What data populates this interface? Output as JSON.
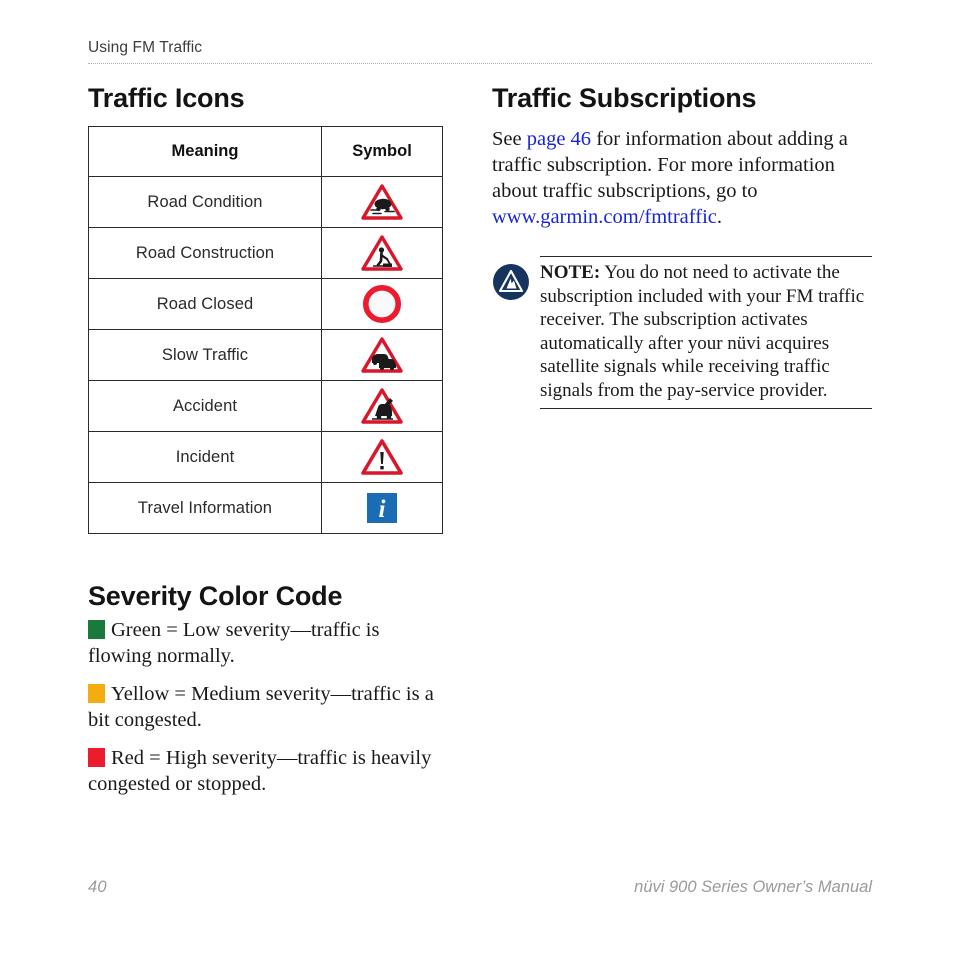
{
  "header": {
    "running_head": "Using FM Traffic"
  },
  "left_column": {
    "traffic_icons": {
      "heading": "Traffic Icons",
      "table": {
        "columns": [
          "Meaning",
          "Symbol"
        ],
        "rows": [
          {
            "meaning": "Road Condition",
            "symbol_icon": "slippery-road-warning-icon"
          },
          {
            "meaning": "Road Construction",
            "symbol_icon": "road-works-warning-icon"
          },
          {
            "meaning": "Road Closed",
            "symbol_icon": "road-closed-circle-icon"
          },
          {
            "meaning": "Slow Traffic",
            "symbol_icon": "traffic-queue-warning-icon"
          },
          {
            "meaning": "Accident",
            "symbol_icon": "accident-warning-icon"
          },
          {
            "meaning": "Incident",
            "symbol_icon": "general-warning-exclamation-icon"
          },
          {
            "meaning": "Travel Information",
            "symbol_icon": "travel-information-info-icon"
          }
        ]
      }
    },
    "severity": {
      "heading": "Severity Color Code",
      "items": [
        {
          "swatch_color": "#1a7a3c",
          "swatch_name": "green-severity-swatch",
          "text": "Green = Low severity—traffic is flowing normally."
        },
        {
          "swatch_color": "#f4ad10",
          "swatch_name": "yellow-severity-swatch",
          "text": "Yellow = Medium severity—traffic is a bit congested."
        },
        {
          "swatch_color": "#ed1b2e",
          "swatch_name": "red-severity-swatch",
          "text": "Red = High severity—traffic is heavily congested or stopped."
        }
      ]
    }
  },
  "right_column": {
    "subscriptions": {
      "heading": "Traffic Subscriptions",
      "paragraph_part1": "See ",
      "link_page": "page 46",
      "paragraph_part2": " for information about adding a traffic subscription. For more information about traffic subscriptions, go to ",
      "link_url": "www.garmin.com/fmtraffic",
      "paragraph_part3": "."
    },
    "note": {
      "icon": "garmin-logo-icon",
      "label": "NOTE:",
      "text": " You do not need to activate the subscription included with your FM traffic receiver. The subscription activates automatically after your nüvi acquires satellite signals while receiving traffic signals from the pay-service provider."
    }
  },
  "footer": {
    "page_number": "40",
    "manual_title": "nüvi 900 Series Owner’s Manual"
  },
  "colors": {
    "link": "#1724d8",
    "warning_red": "#d8172a",
    "info_blue": "#1a6cb5",
    "garmin_navy": "#17345e",
    "rule_gray": "#b6b6b6",
    "footer_gray": "#9a9a9a"
  }
}
